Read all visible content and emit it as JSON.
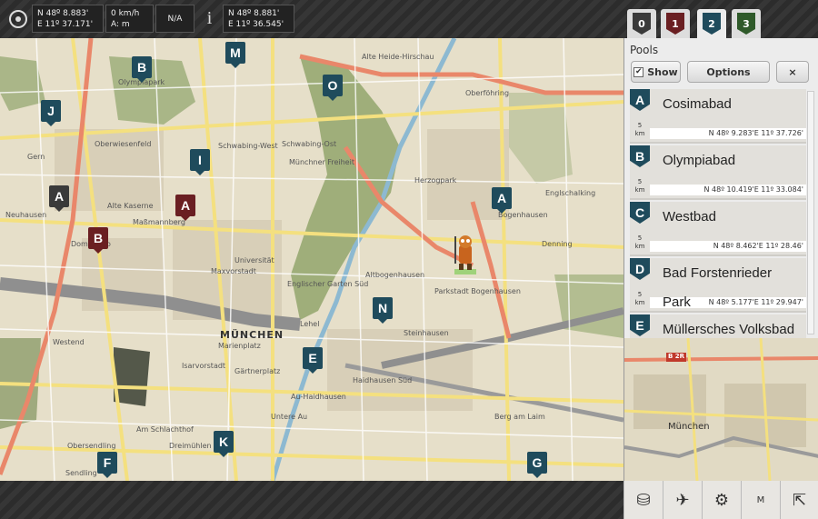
{
  "topbar": {
    "gps_lat": "N 48º 8.883'",
    "gps_lon": "E 11º 37.171'",
    "speed": "0 km/h",
    "accuracy": "A: m",
    "status": "N/A",
    "info_icon": "i",
    "target_lat": "N 48º 8.881'",
    "target_lon": "E 11º 36.545'"
  },
  "tabs": [
    {
      "label": "0",
      "color": "#3a3a3a"
    },
    {
      "label": "1",
      "color": "#6a1f22"
    },
    {
      "label": "2",
      "color": "#1f4b5c"
    },
    {
      "label": "3",
      "color": "#2f5a2a"
    }
  ],
  "panel": {
    "title": "Pools",
    "show_label": "Show",
    "options_label": "Options",
    "close_label": "×"
  },
  "pools": [
    {
      "letter": "A",
      "name": "Cosimabad",
      "distance": "5",
      "unit": "km",
      "coords": "N 48º 9.283'E 11º 37.726'"
    },
    {
      "letter": "B",
      "name": "Olympiabad",
      "distance": "5",
      "unit": "km",
      "coords": "N 48º 10.419'E 11º 33.084'"
    },
    {
      "letter": "C",
      "name": "Westbad",
      "distance": "5",
      "unit": "km",
      "coords": "N 48º 8.462'E 11º 28.46'"
    },
    {
      "letter": "D",
      "name": "Bad Forstenrieder Park",
      "name1": "Bad Forstenrieder",
      "name2": "Park",
      "distance": "5",
      "unit": "km",
      "coords": "N 48º 5.177'E 11º 29.947'"
    },
    {
      "letter": "E",
      "name": "Müllersches Volksbad",
      "distance": "",
      "unit": "",
      "coords": ""
    }
  ],
  "map": {
    "city_label": "MÜNCHEN",
    "places": [
      "Alte Heide-Hirschau",
      "Oberföhring",
      "Bogenhausen",
      "Schwabing-West",
      "Schwabing-Ost",
      "Münchner Freiheit",
      "Neuhausen",
      "Alte Kaserne",
      "Maxvorstadt",
      "Universität",
      "Englischer Garten Süd",
      "Altbogenhausen",
      "Parkstadt Bogenhausen",
      "Steinhausen",
      "Haidhausen Süd",
      "Au-Haidhausen",
      "Untere Au",
      "Berg am Laim",
      "Westend",
      "Sendling",
      "Obersendling",
      "Dreimühlen",
      "Am Schlachthof",
      "Isarvorstadt",
      "Gärtnerplatz",
      "Lehel",
      "Marienplatz",
      "Olympiapark",
      "Dom Pedro",
      "Maßmannberg",
      "Herzogpark",
      "Denning",
      "Englschalking",
      "Oberwiesenfeld",
      "Gern"
    ],
    "markers": [
      {
        "label": "B",
        "style": "teal"
      },
      {
        "label": "M",
        "style": "teal"
      },
      {
        "label": "O",
        "style": "teal"
      },
      {
        "label": "J",
        "style": "teal"
      },
      {
        "label": "I",
        "style": "teal"
      },
      {
        "label": "A",
        "style": "dark"
      },
      {
        "label": "A",
        "style": "red"
      },
      {
        "label": "B",
        "style": "red"
      },
      {
        "label": "A",
        "style": "teal"
      },
      {
        "label": "N",
        "style": "teal"
      },
      {
        "label": "E",
        "style": "teal"
      },
      {
        "label": "K",
        "style": "teal"
      },
      {
        "label": "F",
        "style": "teal"
      },
      {
        "label": "G",
        "style": "teal"
      }
    ]
  },
  "minimap": {
    "city_label": "München",
    "road_label": "B 2R"
  },
  "bottombar": {
    "buttons": [
      {
        "name": "database-icon",
        "glyph": "⛁"
      },
      {
        "name": "airplane-icon",
        "glyph": "✈"
      },
      {
        "name": "gear-icon",
        "glyph": "⚙"
      },
      {
        "name": "m-button",
        "glyph": "M"
      },
      {
        "name": "arrow-up-left-icon",
        "glyph": "⇱"
      }
    ]
  }
}
